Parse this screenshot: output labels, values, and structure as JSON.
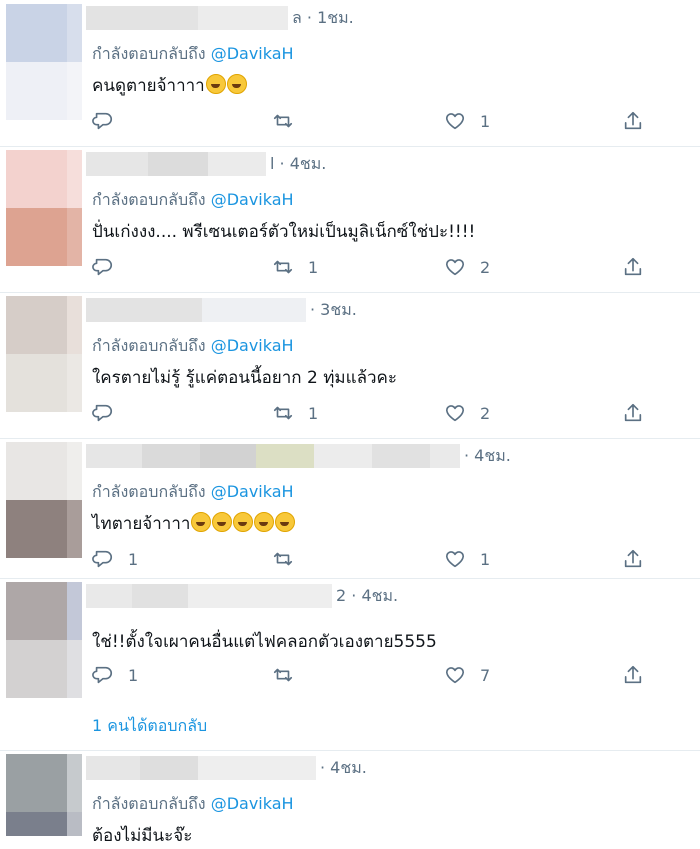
{
  "reply_prefix": "กำลังตอบกลับถึง",
  "reply_handle": "@DavikaH",
  "show_replies": "1 คนได้ตอบกลับ",
  "icons": {
    "reply": "reply-icon",
    "retweet": "retweet-icon",
    "like": "heart-icon",
    "share": "share-icon"
  },
  "colors": {
    "link": "#1b95e0",
    "muted": "#5b7083",
    "divider": "#e6ecf0"
  },
  "tweets": [
    {
      "time": "ล · 1ชม.",
      "text": "คนดูตายจ้าาาา",
      "emoji_count": 2,
      "reply_count": "",
      "retweet_count": "",
      "like_count": "1"
    },
    {
      "time": "l · 4ชม.",
      "text": "ปั่นเก่งงง.... พรีเซนเตอร์ตัวใหม่เป็นมูลิเน็กซ์ใช่ปะ!!!!",
      "emoji_count": 0,
      "reply_count": "",
      "retweet_count": "1",
      "like_count": "2"
    },
    {
      "time": "· 3ชม.",
      "text": "ใครตายไม่รู้ รู้แค่ตอนนี้อยาก 2 ทุ่มแล้วคะ",
      "emoji_count": 0,
      "reply_count": "",
      "retweet_count": "1",
      "like_count": "2"
    },
    {
      "time": "· 4ชม.",
      "text": "ไทตายจ้าาาา",
      "emoji_count": 5,
      "reply_count": "1",
      "retweet_count": "",
      "like_count": "1"
    },
    {
      "time": "2 · 4ชม.",
      "text": "ใช่!!ตั้งใจเผาคนอื่นแต่ไฟคลอกตัวเองตาย5555",
      "emoji_count": 0,
      "reply_count": "1",
      "retweet_count": "",
      "like_count": "7"
    },
    {
      "time": "· 4ชม.",
      "text": "ต้องไม่มีนะจ๊ะ",
      "emoji_count": 0,
      "reply_count": "",
      "retweet_count": "",
      "like_count": ""
    }
  ]
}
